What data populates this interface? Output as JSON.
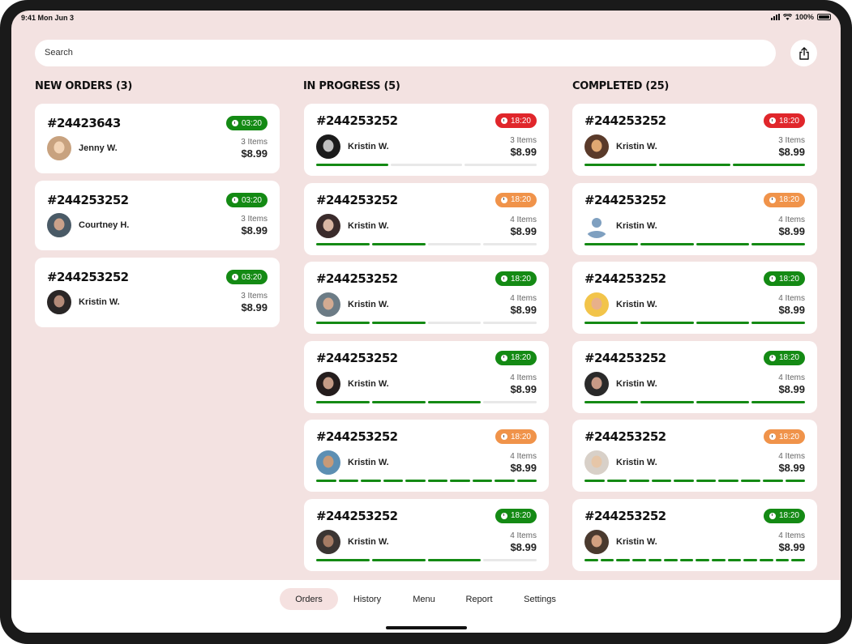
{
  "status": {
    "time": "9:41  Mon Jun 3",
    "battery": "100%"
  },
  "search": {
    "placeholder": "Search"
  },
  "columns": {
    "new": {
      "title": "NEW ORDERS (3)",
      "cards": [
        {
          "order": "#24423643",
          "timer": "03:20",
          "timer_color": "#148a14",
          "name": "Jenny W.",
          "items": "3 Items",
          "price": "$8.99",
          "avatar": "#c8a27f",
          "avatar_fg": "#f2d3b5"
        },
        {
          "order": "#244253252",
          "timer": "03:20",
          "timer_color": "#148a14",
          "name": "Courtney H.",
          "items": "3 Items",
          "price": "$8.99",
          "avatar": "#4a5a66",
          "avatar_fg": "#caa18a"
        },
        {
          "order": "#244253252",
          "timer": "03:20",
          "timer_color": "#148a14",
          "name": "Kristin W.",
          "items": "3 Items",
          "price": "$8.99",
          "avatar": "#2a2626",
          "avatar_fg": "#b38a78"
        }
      ]
    },
    "progress": {
      "title": "IN PROGRESS (5)",
      "cards": [
        {
          "order": "#244253252",
          "timer": "18:20",
          "timer_color": "#e0262b",
          "name": "Kristin W.",
          "items": "3 Items",
          "price": "$8.99",
          "avatar": "#1b1b1b",
          "avatar_fg": "#bfbfbf",
          "steps": 3,
          "done": 1
        },
        {
          "order": "#244253252",
          "timer": "18:20",
          "timer_color": "#f0934a",
          "name": "Kristin W.",
          "items": "4 Items",
          "price": "$8.99",
          "avatar": "#3a2b2b",
          "avatar_fg": "#d9b6a3",
          "steps": 4,
          "done": 2
        },
        {
          "order": "#244253252",
          "timer": "18:20",
          "timer_color": "#148a14",
          "name": "Kristin W.",
          "items": "4 Items",
          "price": "$8.99",
          "avatar": "#6c7c86",
          "avatar_fg": "#d3ab92",
          "steps": 4,
          "done": 2
        },
        {
          "order": "#244253252",
          "timer": "18:20",
          "timer_color": "#148a14",
          "name": "Kristin W.",
          "items": "4 Items",
          "price": "$8.99",
          "avatar": "#241d1d",
          "avatar_fg": "#c49b86",
          "steps": 4,
          "done": 3
        },
        {
          "order": "#244253252",
          "timer": "18:20",
          "timer_color": "#f0934a",
          "name": "Kristin W.",
          "items": "4 Items",
          "price": "$8.99",
          "avatar": "#5d8fb3",
          "avatar_fg": "#c79a78",
          "steps": 10,
          "done": 10
        },
        {
          "order": "#244253252",
          "timer": "18:20",
          "timer_color": "#148a14",
          "name": "Kristin W.",
          "items": "4 Items",
          "price": "$8.99",
          "avatar": "#3b3533",
          "avatar_fg": "#a57b64",
          "steps": 4,
          "done": 3
        }
      ]
    },
    "completed": {
      "title": "COMPLETED (25)",
      "cards": [
        {
          "order": "#244253252",
          "timer": "18:20",
          "timer_color": "#e0262b",
          "name": "Kristin W.",
          "items": "3 Items",
          "price": "$8.99",
          "avatar": "#5a3a2a",
          "avatar_fg": "#e0a872",
          "steps": 3,
          "done": 3
        },
        {
          "order": "#244253252",
          "timer": "18:20",
          "timer_color": "#f0934a",
          "name": "Kristin W.",
          "items": "4 Items",
          "price": "$8.99",
          "avatar": "#ffffff",
          "avatar_fg": "#7fa0c0",
          "steps": 4,
          "done": 4
        },
        {
          "order": "#244253252",
          "timer": "18:20",
          "timer_color": "#148a14",
          "name": "Kristin W.",
          "items": "4 Items",
          "price": "$8.99",
          "avatar": "#f2c44a",
          "avatar_fg": "#e8b08a",
          "steps": 4,
          "done": 4
        },
        {
          "order": "#244253252",
          "timer": "18:20",
          "timer_color": "#148a14",
          "name": "Kristin W.",
          "items": "4 Items",
          "price": "$8.99",
          "avatar": "#2a2a2a",
          "avatar_fg": "#c79a86",
          "steps": 4,
          "done": 4
        },
        {
          "order": "#244253252",
          "timer": "18:20",
          "timer_color": "#f0934a",
          "name": "Kristin W.",
          "items": "4 Items",
          "price": "$8.99",
          "avatar": "#d8d0c8",
          "avatar_fg": "#e6c6a8",
          "steps": 10,
          "done": 10
        },
        {
          "order": "#244253252",
          "timer": "18:20",
          "timer_color": "#148a14",
          "name": "Kristin W.",
          "items": "4 Items",
          "price": "$8.99",
          "avatar": "#4a3a2f",
          "avatar_fg": "#d1a080",
          "steps": 14,
          "done": 14
        }
      ]
    }
  },
  "tabs": [
    {
      "label": "Orders",
      "active": true
    },
    {
      "label": "History",
      "active": false
    },
    {
      "label": "Menu",
      "active": false
    },
    {
      "label": "Report",
      "active": false
    },
    {
      "label": "Settings",
      "active": false
    }
  ]
}
